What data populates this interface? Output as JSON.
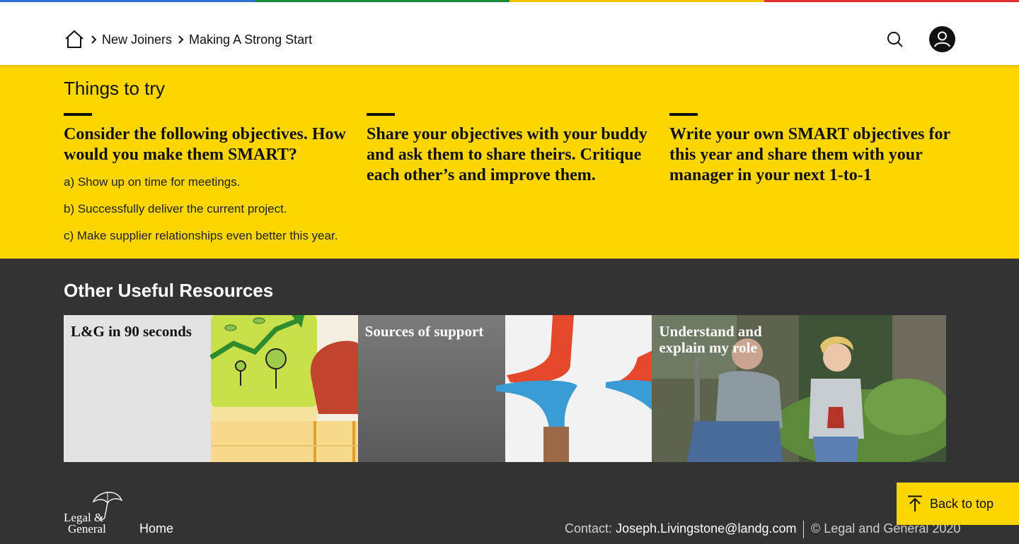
{
  "colors": {
    "top_bar": [
      "#2f6fd0",
      "#1a8a3a",
      "#f2c300",
      "#e03030"
    ],
    "accent_yellow": "#fdd600",
    "dark_bg": "#333333"
  },
  "header": {
    "breadcrumb": {
      "home_icon": "home-icon",
      "items": [
        "New Joiners",
        "Making A Strong Start"
      ]
    },
    "search_icon": "search-icon",
    "avatar_icon": "user-icon"
  },
  "things_to_try": {
    "title": "Things to try",
    "columns": [
      {
        "headline": "Consider the following objectives. How would you make them SMART?",
        "lines": [
          "a) Show up on time for meetings.",
          "b) Successfully deliver the current project.",
          "c) Make supplier relationships even better this year."
        ]
      },
      {
        "headline": "Share your objectives with your buddy and ask them to share theirs. Critique each other’s and improve them.",
        "lines": []
      },
      {
        "headline": "Write your own SMART objectives for this year and share them with your manager in your next 1-to-1",
        "lines": []
      }
    ]
  },
  "resources": {
    "title": "Other Useful Resources",
    "cards": [
      {
        "title": "L&G in 90 seconds"
      },
      {
        "title": "Sources of support"
      },
      {
        "title": "Understand and explain my role"
      }
    ]
  },
  "footer": {
    "logo_text": [
      "Legal &",
      "General"
    ],
    "home_link": "Home",
    "contact_label": "Contact:",
    "contact_email": "Joseph.Livingstone@landg.com",
    "copyright": "© Legal and General 2020"
  },
  "back_to_top": {
    "label": "Back to top",
    "icon": "arrow-up-icon"
  }
}
